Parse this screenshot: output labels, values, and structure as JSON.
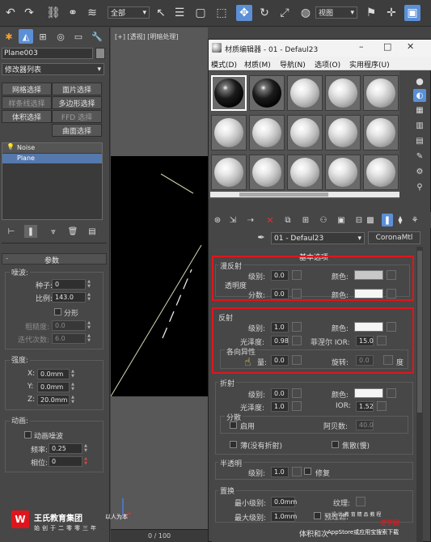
{
  "toolbar": {
    "selection_filter": "全部",
    "viewport_dropdown": "视图"
  },
  "viewport": {
    "label": "[+] [透视] [明暗处理]",
    "timeline": "0 / 100"
  },
  "left_panel": {
    "object_name": "Plane003",
    "modifier_list": "修改器列表",
    "buttons": [
      "网格选择",
      "面片选择",
      "样条线选择",
      "多边形选择",
      "体积选择",
      "FFD 选择",
      "曲面选择"
    ],
    "stack": [
      "Noise",
      "Plane"
    ],
    "params_title": "参数",
    "noise_group": "噪波:",
    "seed_label": "种子:",
    "seed": "0",
    "scale_label": "比例:",
    "scale": "143.0",
    "fractal_label": "分形",
    "roughness_label": "粗糙度:",
    "roughness": "0.0",
    "iterations_label": "迭代次数:",
    "iterations": "6.0",
    "strength_group": "强度:",
    "x_label": "X:",
    "x": "0.0mm",
    "y_label": "Y:",
    "y": "0.0mm",
    "z_label": "Z:",
    "z": "20.0mm",
    "anim_group": "动画:",
    "anim_noise": "动画噪波",
    "freq_label": "频率:",
    "freq": "0.25",
    "phase_label": "相位:",
    "phase": "0"
  },
  "mat_editor": {
    "title": "材质编辑器 - 01 - Defaul23",
    "menu": [
      "模式(D)",
      "材质(M)",
      "导航(N)",
      "选项(O)",
      "实用程序(U)"
    ],
    "material_name": "01 - Defaul23",
    "material_type": "CoronaMtl",
    "basic_header": "基本选项",
    "diffuse_group": "漫反射",
    "translucency_group": "透明度",
    "level_label": "级别:",
    "diffuse_level": "0.0",
    "color_label": "颜色:",
    "fraction_label": "分数:",
    "fraction": "0.0",
    "reflect_group": "反射",
    "reflect_level": "1.0",
    "gloss_label": "光泽度:",
    "reflect_gloss": "0.98",
    "fresnel_label": "菲涅尔 IOR:",
    "fresnel": "15.0",
    "aniso_group": "各向异性",
    "amount_label": "量:",
    "aniso_amount": "0.0",
    "rotation_label": "旋转:",
    "rotation": "0.0",
    "deg_label": "度",
    "refract_group": "折射",
    "refract_level": "0.0",
    "refract_gloss": "1.0",
    "ior_label": "IOR:",
    "ior": "1.52",
    "dispersion_group": "分散",
    "enable_label": "启用",
    "abbe_label": "阿贝数:",
    "abbe": "40.0",
    "thin_label": "薄(没有折射)",
    "caustics_label": "焦散(慢)",
    "translucent_group": "半透明",
    "translucent_level": "1.0",
    "fix_label": "修复",
    "displace_group": "置换",
    "min_label": "最小级别:",
    "min_level": "0.0mm",
    "texture_label": "纹理:",
    "max_label": "最大级别:",
    "max_level": "1.0mm",
    "filter_label": "预过滤:",
    "bottom_rollout": "体积和次"
  },
  "watermark": {
    "brand": "王氏教育集团",
    "slogan": "以人为本",
    "sub": "始创于二零零三年",
    "appstore": "AppStore或应用宝搜索下载",
    "right_text": "设 计 教 育 精 品 教 程",
    "logo_text": "信学网"
  },
  "colors": {
    "highlight_red": "#e0151c",
    "accent_blue": "#5b8fd6",
    "window_bg": "#444444"
  }
}
